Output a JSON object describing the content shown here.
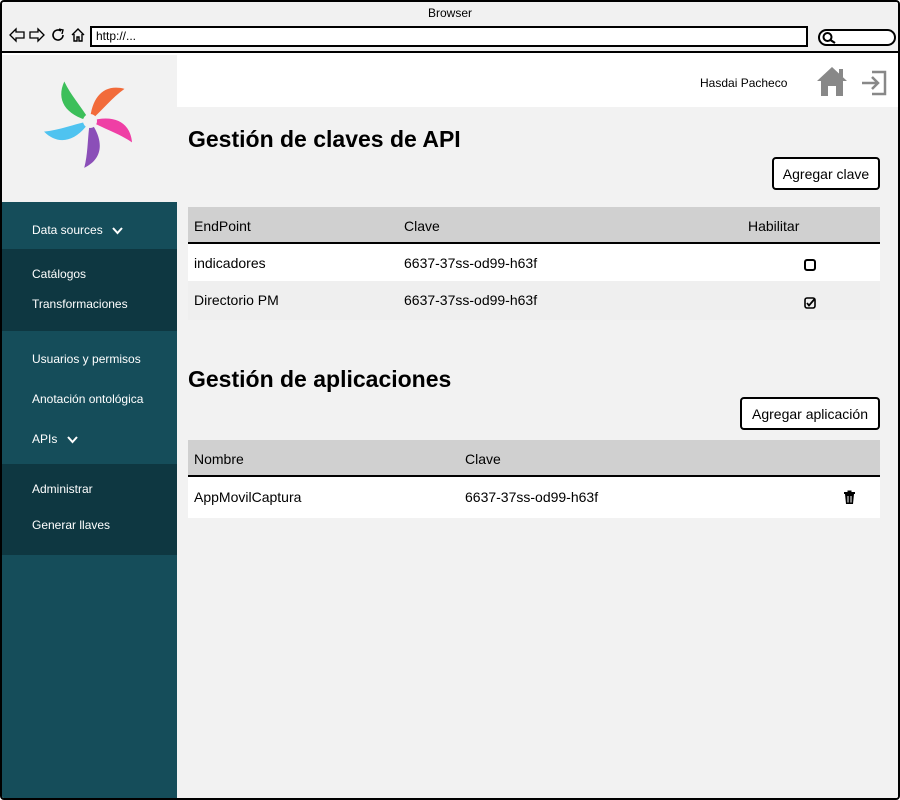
{
  "browser": {
    "title": "Browser",
    "url": "http://..."
  },
  "sidebar": {
    "data_sources_label": "Data sources",
    "data_sources_items": [
      "Catálogos",
      "Transformaciones"
    ],
    "usuarios_label": "Usuarios y permisos",
    "anotacion_label": "Anotación ontológica",
    "apis_label": "APIs",
    "apis_items": [
      "Administrar",
      "Generar llaves"
    ]
  },
  "header": {
    "username": "Hasdai Pacheco"
  },
  "api_keys": {
    "title": "Gestión de claves de API",
    "add_button": "Agregar clave",
    "columns": [
      "EndPoint",
      "Clave",
      "Habilitar"
    ],
    "rows": [
      {
        "endpoint": "indicadores",
        "clave": "6637-37ss-od99-h63f",
        "enabled": false
      },
      {
        "endpoint": "Directorio PM",
        "clave": "6637-37ss-od99-h63f",
        "enabled": true
      }
    ]
  },
  "apps": {
    "title": "Gestión de aplicaciones",
    "add_button": "Agregar aplicación",
    "columns": [
      "Nombre",
      "Clave"
    ],
    "rows": [
      {
        "nombre": "AppMovilCaptura",
        "clave": "6637-37ss-od99-h63f"
      }
    ]
  }
}
